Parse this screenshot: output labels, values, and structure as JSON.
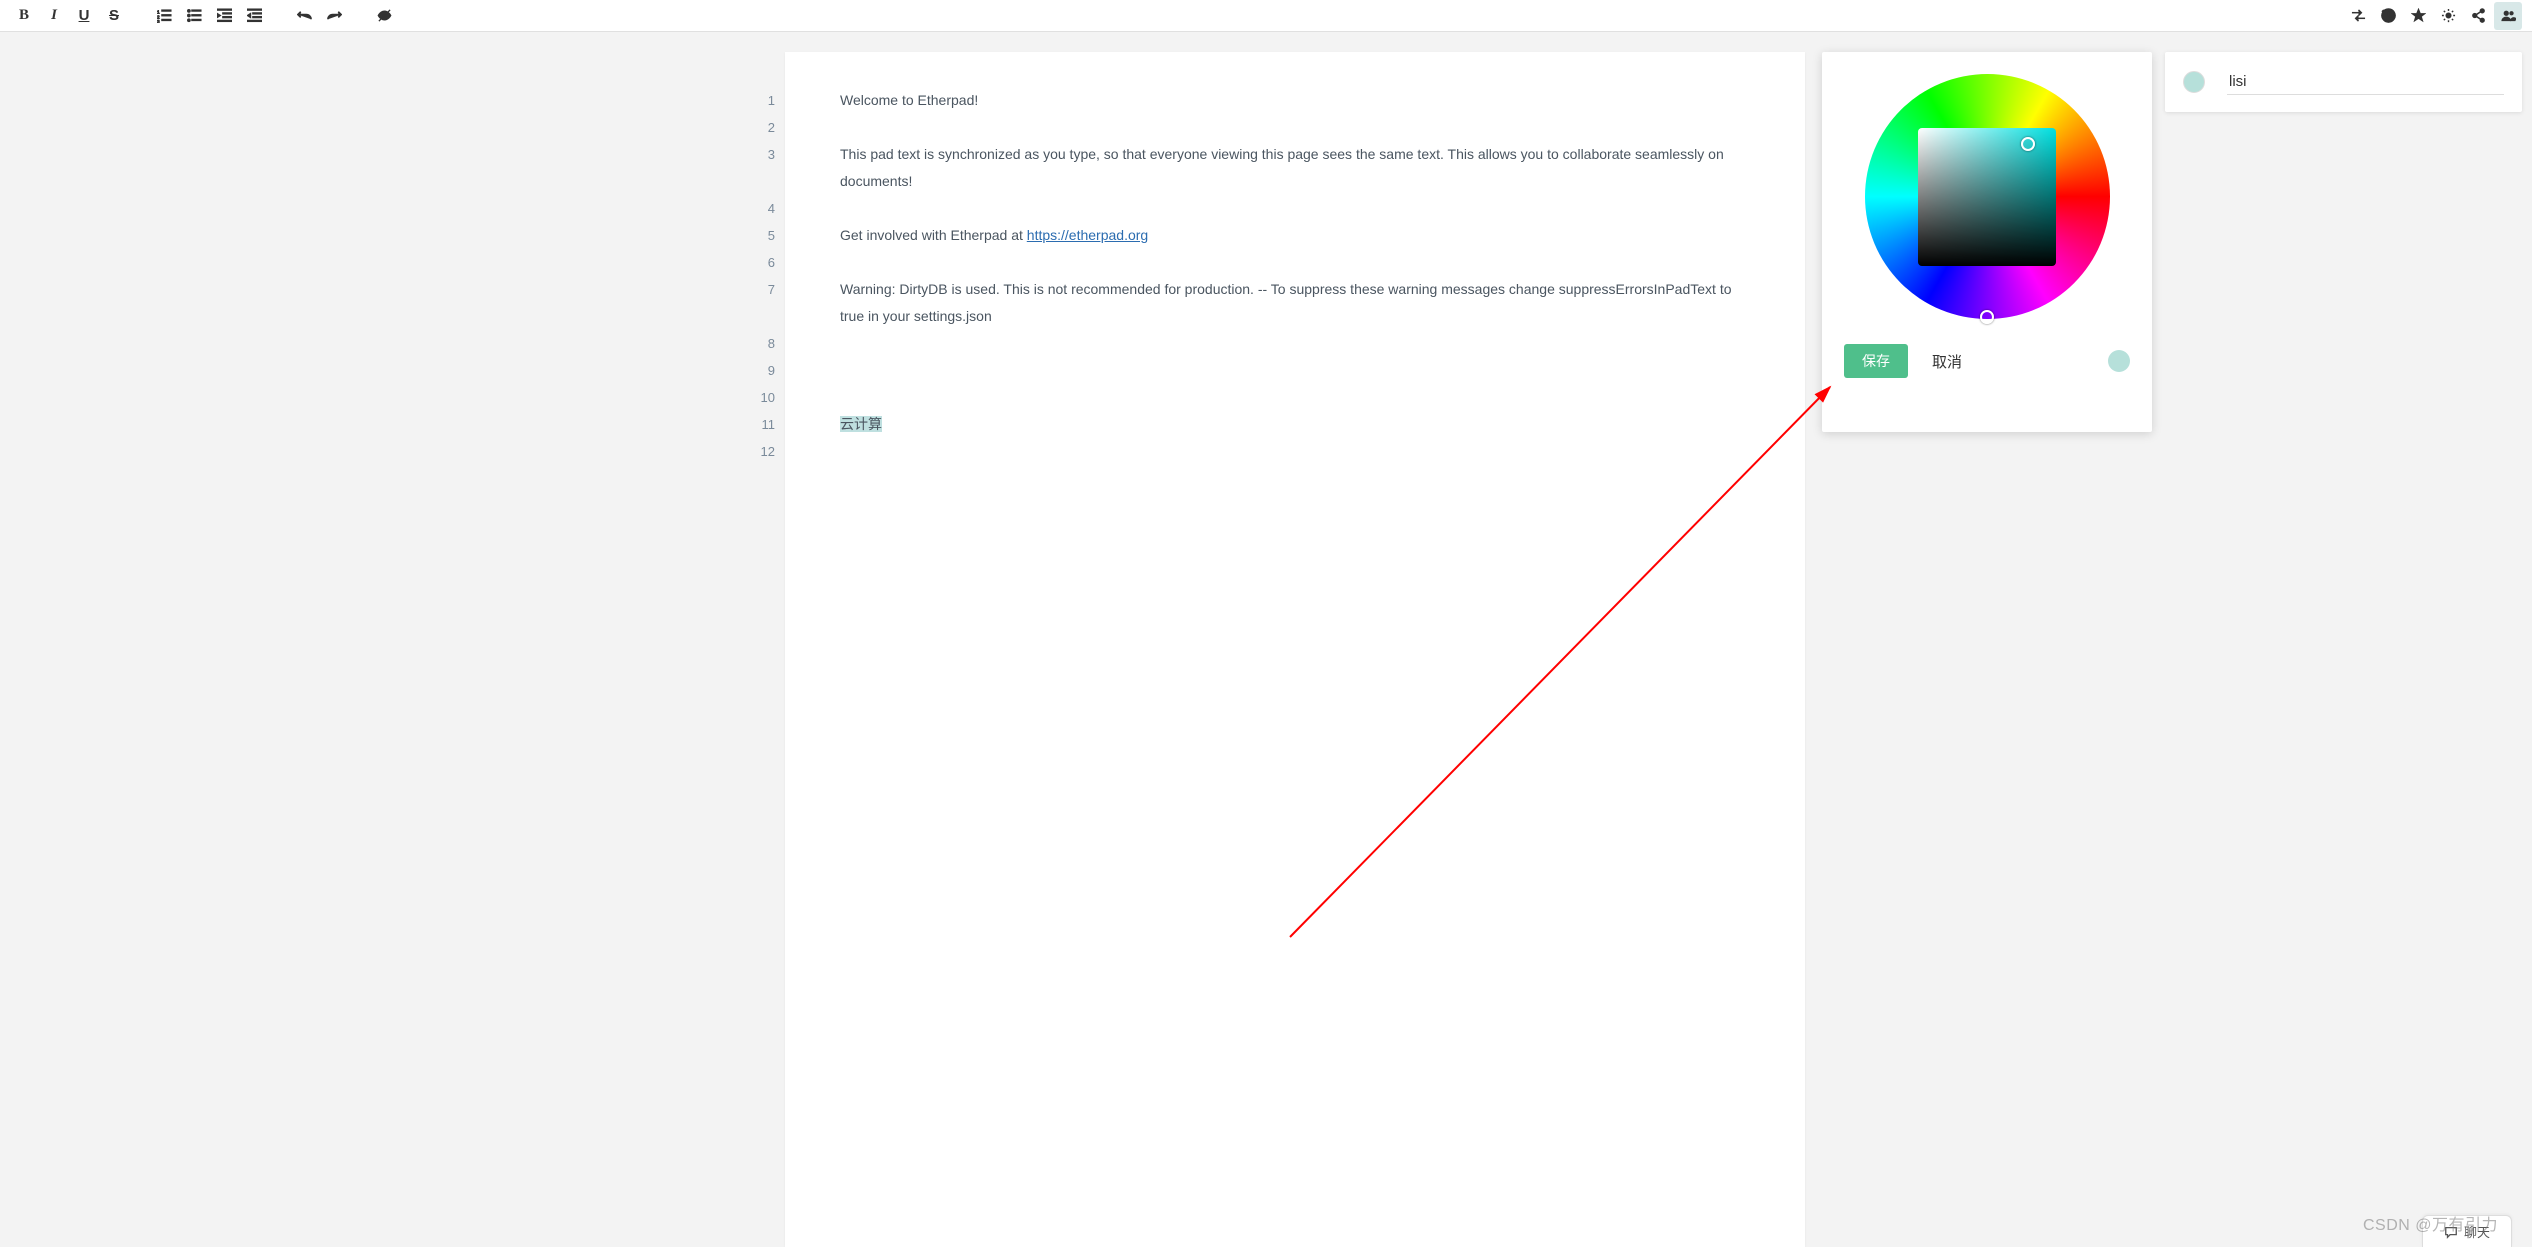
{
  "toolbar": {
    "bold": "B",
    "italic": "I",
    "underline": "U",
    "strike": "S"
  },
  "line_numbers": [
    "1",
    "2",
    "3",
    "4",
    "5",
    "6",
    "7",
    "8",
    "9",
    "10",
    "11",
    "12"
  ],
  "editor": {
    "l1": "Welcome to Etherpad!",
    "l3a": "This pad text is synchronized as you type, so that everyone viewing this page sees the same text. This allows you to collaborate seamlessly on documents!",
    "l5_pre": "Get involved with Etherpad at ",
    "l5_link_text": "https://etherpad.org",
    "l5_link_href": "https://etherpad.org",
    "l7": "Warning: DirtyDB is used. This is not recommended for production. -- To suppress these warning messages change suppressErrorsInPadText to true in your settings.json",
    "l11": "云计算"
  },
  "color_popup": {
    "save": "保存",
    "cancel": "取消",
    "selected_color": "#b6e0da"
  },
  "user_panel": {
    "name": "lisi",
    "color": "#b6e0da"
  },
  "chat": {
    "label": "聊天"
  },
  "watermark": "CSDN @万有引力"
}
